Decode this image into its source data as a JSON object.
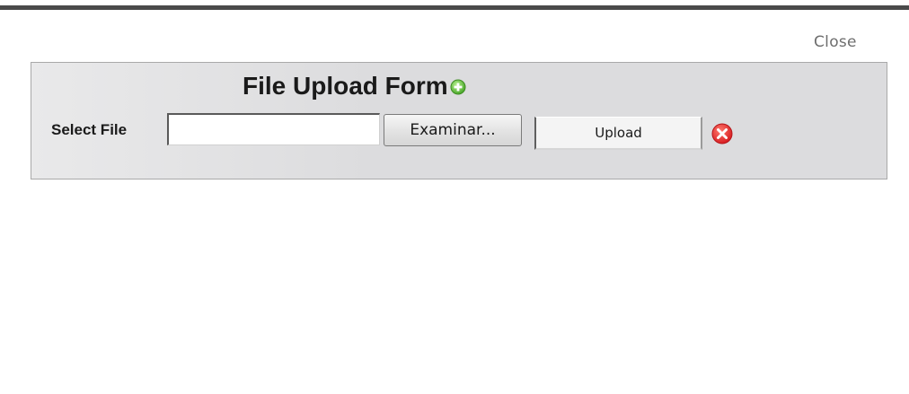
{
  "dialog": {
    "close_label": "Close"
  },
  "form": {
    "title": "File Upload Form",
    "title_icon": "add-circle-icon",
    "select_file_label": "Select File",
    "file_input_value": "",
    "browse_label": "Examinar...",
    "upload_label": "Upload",
    "remove_icon": "remove-circle-icon"
  },
  "colors": {
    "top_bar": "#4a4a4a",
    "panel_background": "#dcdcde",
    "add_icon_green": "#5fbf3a",
    "remove_icon_red": "#e0262d"
  }
}
